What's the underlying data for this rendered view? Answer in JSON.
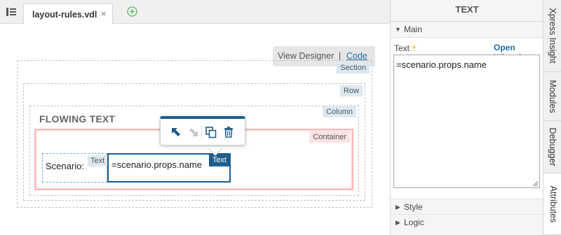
{
  "editor": {
    "file_tab": {
      "label": "layout-rules.vdl",
      "close_glyph": "×"
    },
    "view_toggle": {
      "designer_label": "View Designer",
      "separator": "|",
      "code_label": "Code"
    }
  },
  "canvas": {
    "section_tag": "Section",
    "row_tag": "Row",
    "column_tag": "Column",
    "container_tag": "Container",
    "column_title": "FLOWING TEXT",
    "text1": {
      "value": "Scenario:",
      "tag": "Text"
    },
    "text2": {
      "value": "=scenario.props.name",
      "tag": "Text"
    }
  },
  "toolbar": {
    "icons": [
      "select-parent-icon",
      "select-child-icon",
      "duplicate-icon",
      "delete-icon"
    ]
  },
  "panel": {
    "title": "TEXT",
    "main_label": "Main",
    "text_label": "Text",
    "open_wizard_label": "Open Wizard",
    "text_value": "=scenario.props.name",
    "style_label": "Style",
    "logic_label": "Logic"
  },
  "side_tabs": [
    "Xpress Insight",
    "Modules",
    "Debugger",
    "Attributes"
  ],
  "colors": {
    "accent": "#1f5d8c",
    "link": "#1d6fa8",
    "container_border": "#f4b8b8",
    "tag_bg": "#dde9f2",
    "bolt": "#f2a300",
    "add_tab": "#5cb85c"
  }
}
